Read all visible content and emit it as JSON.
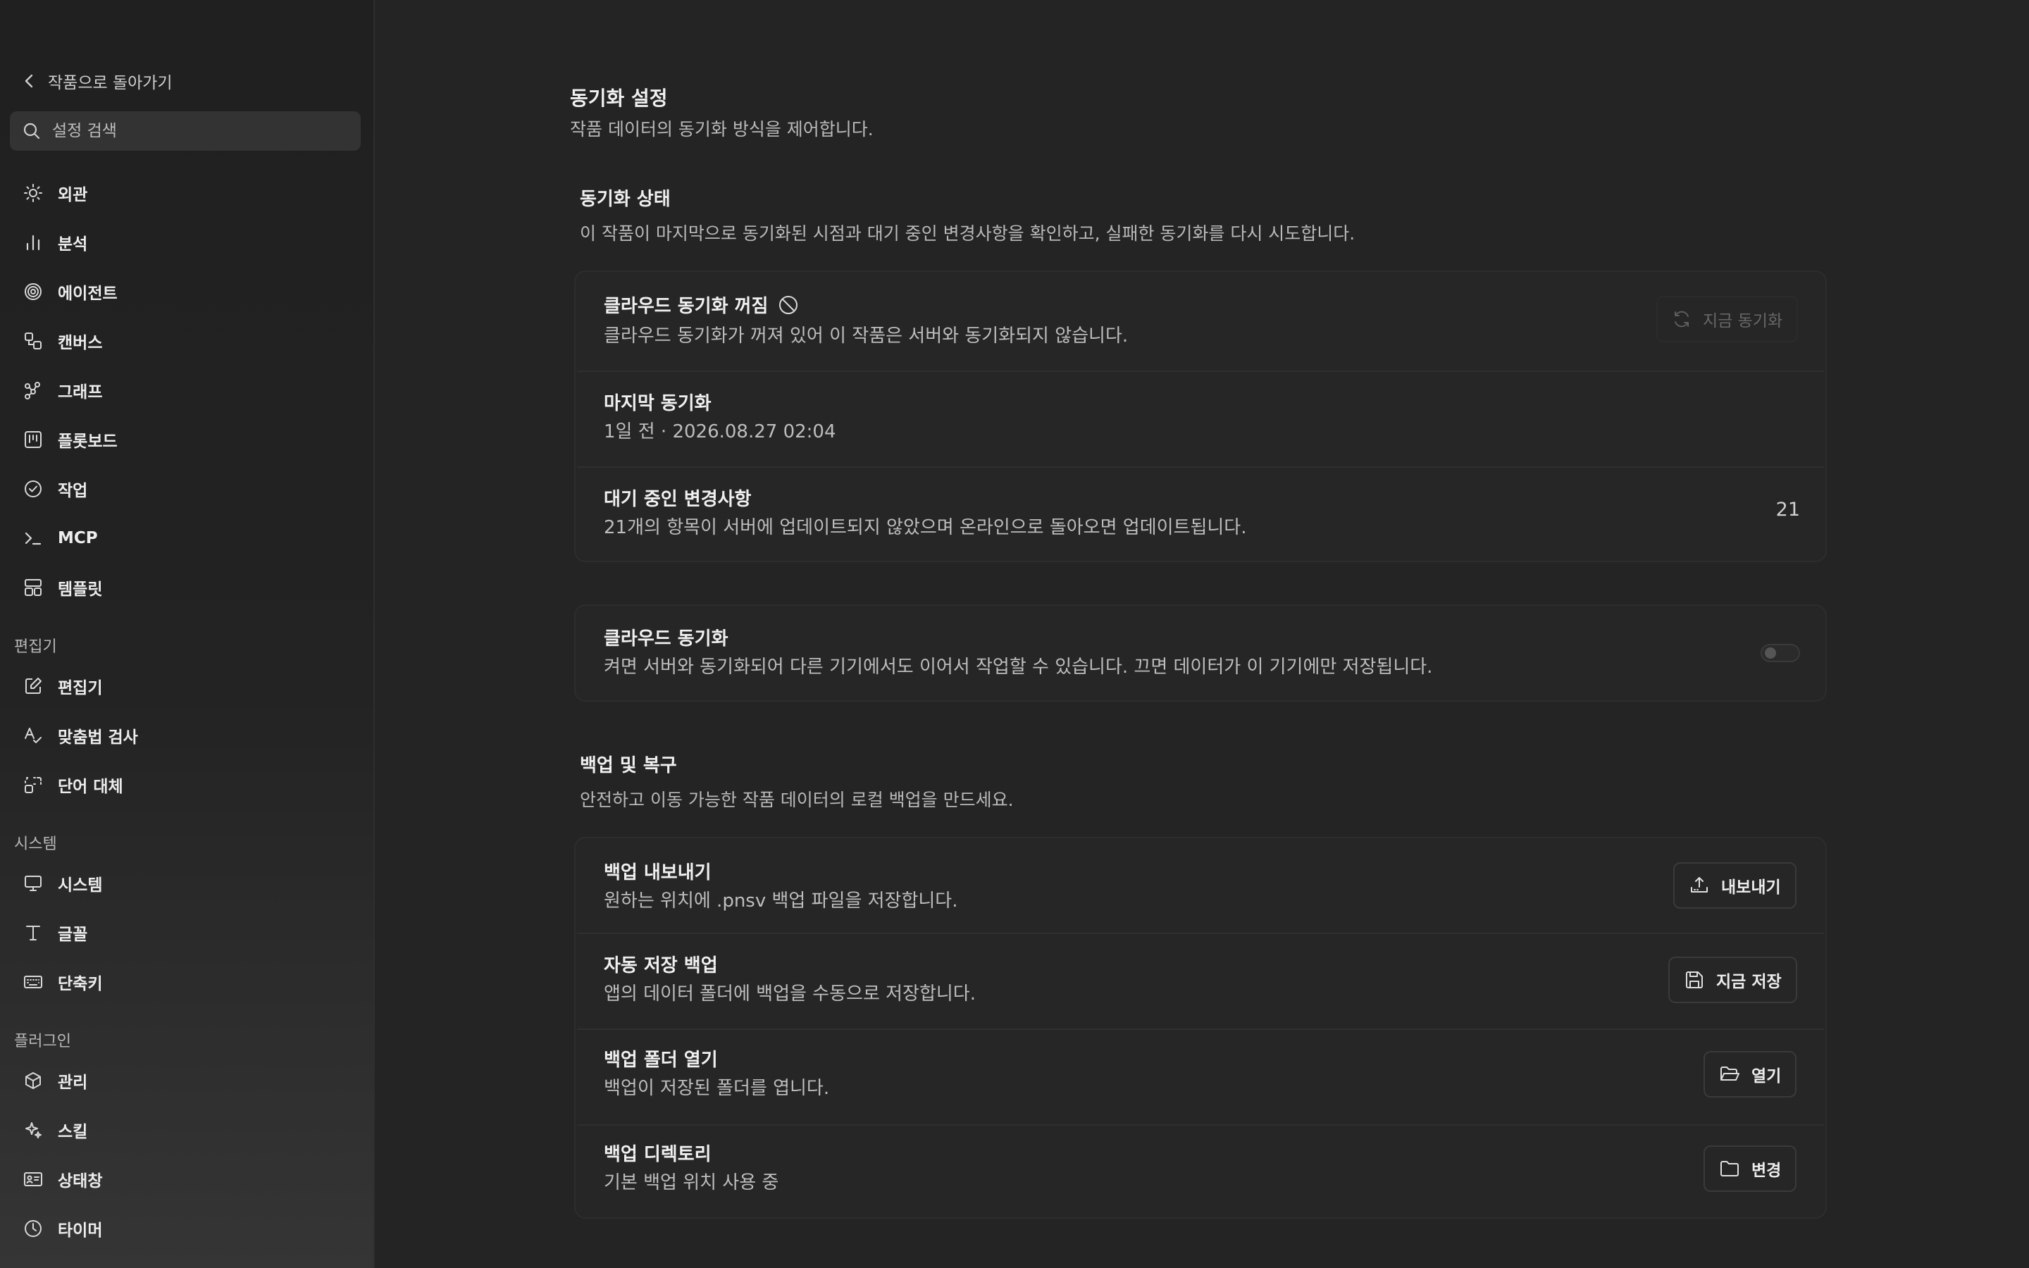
{
  "sidebar": {
    "back_label": "작품으로 돌아가기",
    "search_placeholder": "설정 검색",
    "groups": [
      {
        "items": [
          {
            "label": "외관",
            "icon": "sun-icon"
          },
          {
            "label": "분석",
            "icon": "bar-chart-icon"
          },
          {
            "label": "에이전트",
            "icon": "spiral-icon"
          },
          {
            "label": "캔버스",
            "icon": "shapes-icon"
          },
          {
            "label": "그래프",
            "icon": "graph-nodes-icon"
          },
          {
            "label": "플롯보드",
            "icon": "kanban-icon"
          },
          {
            "label": "작업",
            "icon": "check-circle-icon"
          },
          {
            "label": "MCP",
            "icon": "terminal-icon"
          },
          {
            "label": "템플릿",
            "icon": "layout-template-icon"
          }
        ]
      },
      {
        "title": "편집기",
        "items": [
          {
            "label": "편집기",
            "icon": "pencil-square-icon"
          },
          {
            "label": "맞춤법 검사",
            "icon": "spell-check-icon"
          },
          {
            "label": "단어 대체",
            "icon": "replace-icon"
          }
        ]
      },
      {
        "title": "시스템",
        "items": [
          {
            "label": "시스템",
            "icon": "monitor-icon"
          },
          {
            "label": "글꼴",
            "icon": "type-icon"
          },
          {
            "label": "단축키",
            "icon": "keyboard-icon"
          }
        ]
      },
      {
        "title": "플러그인",
        "items": [
          {
            "label": "관리",
            "icon": "package-icon"
          },
          {
            "label": "스킬",
            "icon": "sparkles-icon"
          },
          {
            "label": "상태창",
            "icon": "id-card-icon"
          },
          {
            "label": "타이머",
            "icon": "clock-icon"
          }
        ]
      }
    ]
  },
  "main": {
    "title": "동기화 설정",
    "subtitle": "작품 데이터의 동기화 방식을 제어합니다.",
    "sync_status": {
      "heading": "동기화 상태",
      "description": "이 작품이 마지막으로 동기화된 시점과 대기 중인 변경사항을 확인하고, 실패한 동기화를 다시 시도합니다.",
      "cloud_off_title": "클라우드 동기화 꺼짐",
      "cloud_off_desc": "클라우드 동기화가 꺼져 있어 이 작품은 서버와 동기화되지 않습니다.",
      "sync_now_label": "지금 동기화",
      "last_sync_title": "마지막 동기화",
      "last_sync_value": "1일 전 · 2026.08.27 02:04",
      "pending_title": "대기 중인 변경사항",
      "pending_desc": "21개의 항목이 서버에 업데이트되지 않았으며 온라인으로 돌아오면 업데이트됩니다.",
      "pending_count": "21"
    },
    "cloud_sync": {
      "title": "클라우드 동기화",
      "description": "켜면 서버와 동기화되어 다른 기기에서도 이어서 작업할 수 있습니다. 끄면 데이터가 이 기기에만 저장됩니다.",
      "enabled": false
    },
    "backup": {
      "heading": "백업 및 복구",
      "description": "안전하고 이동 가능한 작품 데이터의 로컬 백업을 만드세요.",
      "rows": [
        {
          "title": "백업 내보내기",
          "desc": "원하는 위치에 .pnsv 백업 파일을 저장합니다.",
          "button": "내보내기",
          "icon": "export-icon"
        },
        {
          "title": "자동 저장 백업",
          "desc": "앱의 데이터 폴더에 백업을 수동으로 저장합니다.",
          "button": "지금 저장",
          "icon": "save-icon"
        },
        {
          "title": "백업 폴더 열기",
          "desc": "백업이 저장된 폴더를 엽니다.",
          "button": "열기",
          "icon": "folder-open-icon"
        },
        {
          "title": "백업 디렉토리",
          "desc": "기본 백업 위치 사용 중",
          "button": "변경",
          "icon": "folder-icon"
        }
      ]
    }
  }
}
